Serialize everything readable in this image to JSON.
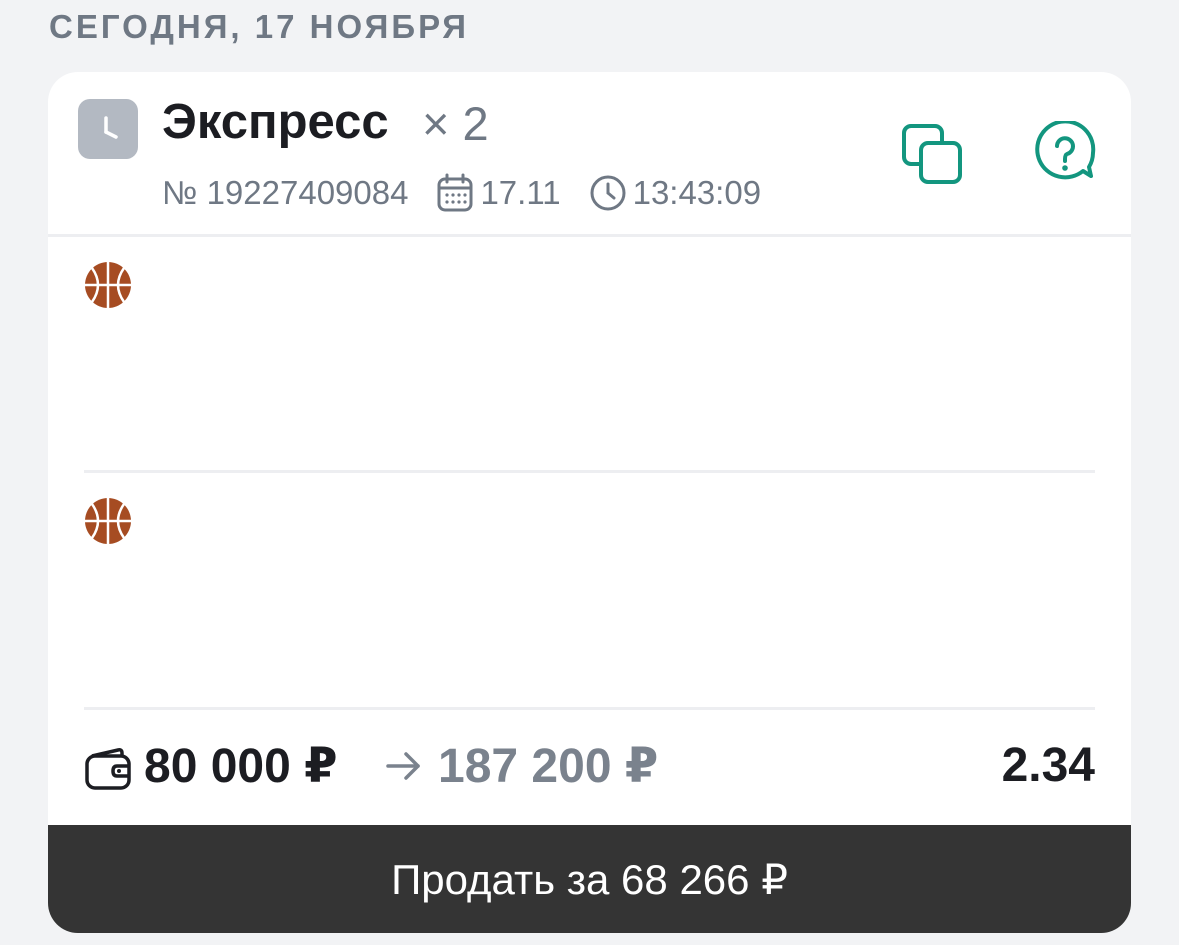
{
  "date_header": "СЕГОДНЯ, 17 НОЯБРЯ",
  "bet": {
    "title": "Экспресс",
    "multiplier": "× 2",
    "number": "№ 19227409084",
    "date": "17.11",
    "time": "13:43:09"
  },
  "events": [
    {
      "sport_icon": "basketball-icon"
    },
    {
      "sport_icon": "basketball-icon"
    }
  ],
  "summary": {
    "stake": "80 000 ₽",
    "payout": "187 200 ₽",
    "odds": "2.34"
  },
  "sell_button_label": "Продать за 68 266 ₽",
  "colors": {
    "accent_teal": "#13967f",
    "basketball": "#a64c22",
    "muted_text": "#6f7884",
    "sell_button_bg": "#343434"
  }
}
